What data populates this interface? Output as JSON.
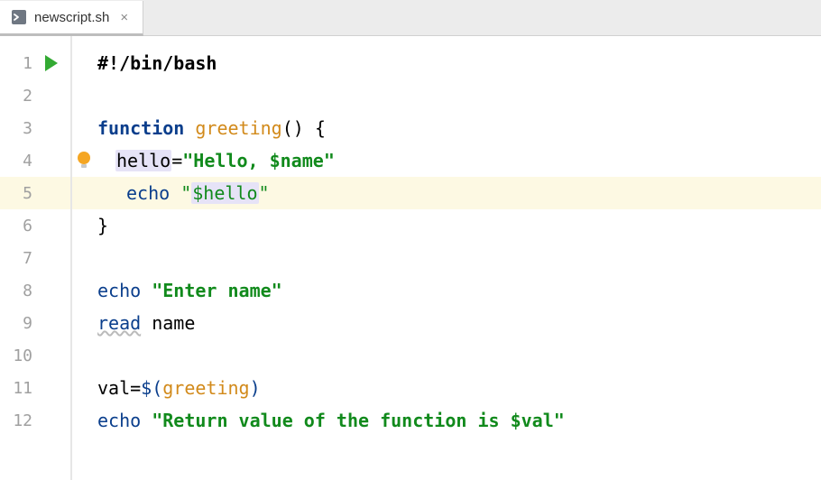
{
  "tab": {
    "filename": "newscript.sh",
    "close_glyph": "×"
  },
  "gutter": {
    "lines": [
      "1",
      "2",
      "3",
      "4",
      "5",
      "6",
      "7",
      "8",
      "9",
      "10",
      "11",
      "12"
    ],
    "run_on_line": 1,
    "highlighted_line": 5
  },
  "code": {
    "l1_shebang": "#!/bin/bash",
    "l3_kw_function": "function",
    "l3_funcname": "greeting",
    "l3_paren_brace": "() {",
    "l4_var": "hello",
    "l4_eq": "=",
    "l4_str_open": "\"Hello, ",
    "l4_str_var": "$name",
    "l4_str_close": "\"",
    "l5_echo": "echo",
    "l5_q1": "\"",
    "l5_var": "$hello",
    "l5_q2": "\"",
    "l6_brace": "}",
    "l8_echo": "echo",
    "l8_str": "\"Enter name\"",
    "l9_read": "read",
    "l9_name": "name",
    "l11_val": "val",
    "l11_eq": "=",
    "l11_dollar_open": "$(",
    "l11_call": "greeting",
    "l11_close": ")",
    "l12_echo": "echo",
    "l12_str_open": "\"Return value of the function is ",
    "l12_str_var": "$val",
    "l12_str_close": "\""
  },
  "icons": {
    "bulb": "lightbulb-icon",
    "run": "run-icon",
    "filetype": "shell-file-icon",
    "close": "close-icon"
  },
  "colors": {
    "keyword": "#0a3e8c",
    "function": "#d28a1b",
    "string": "#118a1c",
    "line_highlight": "#fdf9e3",
    "var_highlight": "#e6e3f7"
  }
}
